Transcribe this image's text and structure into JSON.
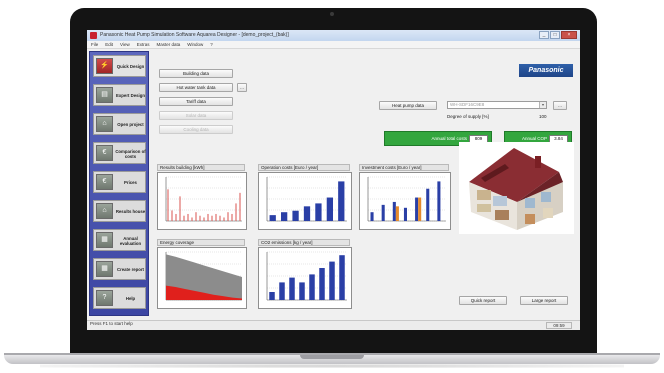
{
  "app": {
    "title": "Panasonic Heat Pump Simulation Software Aquarea Designer - [demo_project_(bak)]",
    "window_buttons": [
      "_",
      "□",
      "×"
    ],
    "brand_color": "#c8202f"
  },
  "menu": [
    "File",
    "Edit",
    "View",
    "Extras",
    "Master data",
    "Window",
    "?"
  ],
  "sidebar": {
    "items": [
      {
        "label": "Quick Design",
        "icon": "quick-design-icon",
        "glyph": "⚡"
      },
      {
        "label": "Expert Design",
        "icon": "expert-design-icon",
        "glyph": "▤"
      },
      {
        "label": "Open project",
        "icon": "open-project-icon",
        "glyph": "⌂"
      },
      {
        "label": "Comparison of costs",
        "icon": "comparison-icon",
        "glyph": "€"
      },
      {
        "label": "Prices",
        "icon": "prices-icon",
        "glyph": "€"
      },
      {
        "label": "Results house",
        "icon": "results-house-icon",
        "glyph": "⌂"
      },
      {
        "label": "Annual evaluation",
        "icon": "annual-evaluation-icon",
        "glyph": "▦"
      },
      {
        "label": "Create report",
        "icon": "create-report-icon",
        "glyph": "▦"
      },
      {
        "label": "Help",
        "icon": "help-icon",
        "glyph": "?"
      }
    ]
  },
  "buttons": {
    "building": "Building data",
    "hot_water": "Hot water tank data",
    "tariff": "Tariff data",
    "solar": "Solar data",
    "cooling": "Cooling data",
    "small": "..."
  },
  "logo": "Panasonic",
  "heat_pump": {
    "button": "Heat pump data",
    "value": "WH-SDF16C9E8",
    "degree_label": "Degree of supply [%]",
    "degree_value": "100"
  },
  "annual_costs": {
    "label": "Annual total costs",
    "value": "809"
  },
  "annual_cop": {
    "label": "Annual COP",
    "value": "3.84"
  },
  "charts": {
    "results_building": "Results building [kWh]",
    "operation_costs": "Operation costs [Euro / year]",
    "investment_costs": "Investment costs [Euro / year]",
    "energy_coverage": "Energy coverage",
    "co2": "CO2 emissions [kg / year]"
  },
  "report_buttons": {
    "quick": "Quick report",
    "large": "Large report"
  },
  "status": {
    "text": "Press F1 to start help",
    "time": "09:59"
  },
  "chart_data": [
    {
      "type": "bar",
      "title": "Results building [kWh]",
      "series": [
        {
          "name": "",
          "color": "#d9534f",
          "values": [
            18,
            6,
            4,
            14,
            3,
            4,
            2,
            5,
            3,
            2,
            4,
            3,
            4,
            3,
            2,
            5,
            4,
            10,
            16
          ]
        }
      ],
      "ylim": [
        0,
        25
      ]
    },
    {
      "type": "bar",
      "title": "Operation costs [Euro / year]",
      "series": [
        {
          "name": "",
          "color": "#2a3fa6",
          "values": [
            4,
            6,
            7,
            10,
            12,
            16,
            27
          ]
        }
      ],
      "ylim": [
        0,
        30
      ]
    },
    {
      "type": "bar",
      "title": "Investment costs [Euro / year]",
      "series": [
        {
          "name": "",
          "color": "#2a3fa6",
          "values": [
            6,
            11,
            13,
            9,
            16,
            22,
            27
          ]
        },
        {
          "name": "",
          "color": "#e58a2c",
          "values": [
            0,
            0,
            10,
            0,
            16,
            0,
            0
          ]
        }
      ],
      "ylim": [
        0,
        30
      ]
    },
    {
      "type": "area",
      "title": "Energy coverage",
      "series": [
        {
          "name": "",
          "color": "#8c8c8c",
          "values": [
            95,
            90,
            84,
            78,
            72,
            66,
            60,
            54,
            48
          ]
        },
        {
          "name": "",
          "color": "#e0201c",
          "values": [
            30,
            27,
            23,
            19,
            15,
            11,
            8,
            5,
            3
          ]
        }
      ],
      "ylim": [
        0,
        100
      ]
    },
    {
      "type": "bar",
      "title": "CO2 emissions [kg / year]",
      "series": [
        {
          "name": "",
          "color": "#2a3fa6",
          "values": [
            5,
            11,
            14,
            11,
            16,
            20,
            24,
            28
          ]
        }
      ],
      "ylim": [
        0,
        30
      ]
    }
  ]
}
